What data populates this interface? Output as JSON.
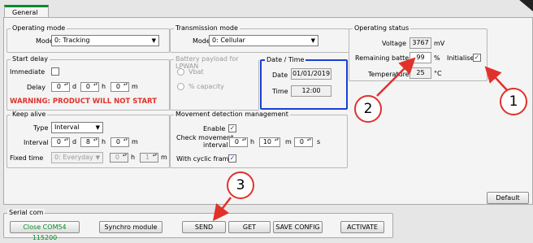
{
  "tab": {
    "label": "General"
  },
  "operating_mode": {
    "legend": "Operating mode",
    "mode_label": "Mode",
    "mode_value": "0: Tracking"
  },
  "transmission_mode": {
    "legend": "Transmission mode",
    "mode_label": "Mode",
    "mode_value": "0: Cellular"
  },
  "operating_status": {
    "legend": "Operating status",
    "voltage_label": "Voltage",
    "voltage_value": "3767",
    "voltage_unit": "mV",
    "battery_label": "Remaining battery",
    "battery_value": "99",
    "battery_unit": "%",
    "initialise_label": "Initialise",
    "temperature_label": "Temperature",
    "temperature_value": "25",
    "temperature_unit": "°C"
  },
  "start_delay": {
    "legend": "Start delay",
    "immediate_label": "Immediate",
    "delay_label": "Delay",
    "days": "0",
    "days_unit": "d",
    "hours": "0",
    "hours_unit": "h",
    "minutes": "0",
    "minutes_unit": "m",
    "warning": "WARNING: PRODUCT WILL NOT START"
  },
  "battery_payload": {
    "legend": "Battery payload for LPWAN",
    "option_vbat": "Vbat",
    "option_capacity": "% capacity"
  },
  "date_time": {
    "legend": "Date / Time",
    "date_label": "Date",
    "date_value": "01/01/2019",
    "time_label": "Time",
    "time_value": "12:00"
  },
  "keep_alive": {
    "legend": "Keep alive",
    "type_label": "Type",
    "type_value": "Interval",
    "interval_label": "Interval",
    "days": "0",
    "days_unit": "d",
    "hours": "8",
    "hours_unit": "h",
    "minutes": "0",
    "minutes_unit": "m",
    "fixed_time_label": "Fixed time",
    "fixed_day": "0: Everyday",
    "fixed_hours": "0",
    "fixed_hours_unit": "h",
    "fixed_minutes": "1",
    "fixed_minutes_unit": "m"
  },
  "movement": {
    "legend": "Movement detection management",
    "enable_label": "Enable",
    "check_label_1": "Check movement",
    "check_label_2": "interval",
    "hours": "0",
    "hours_unit": "h",
    "minutes": "10",
    "minutes_unit": "m",
    "seconds": "0",
    "seconds_unit": "s",
    "cyclic_label": "With cyclic frame"
  },
  "buttons": {
    "default": "Default",
    "close_com": "Close COM54 115200",
    "synchro": "Synchro module",
    "send": "SEND",
    "get": "GET",
    "save_config": "SAVE CONFIG",
    "activate": "ACTIVATE"
  },
  "serial_com": {
    "legend": "Serial com"
  },
  "annotations": {
    "one": "1",
    "two": "2",
    "three": "3"
  },
  "checkmark": "✓",
  "colors": {
    "accent_tab": "#0a8a2a",
    "highlight_box": "#1a3fd6",
    "annotation": "#e0322a",
    "warning": "#e0322a",
    "close_button_text": "#0a8a2a"
  }
}
